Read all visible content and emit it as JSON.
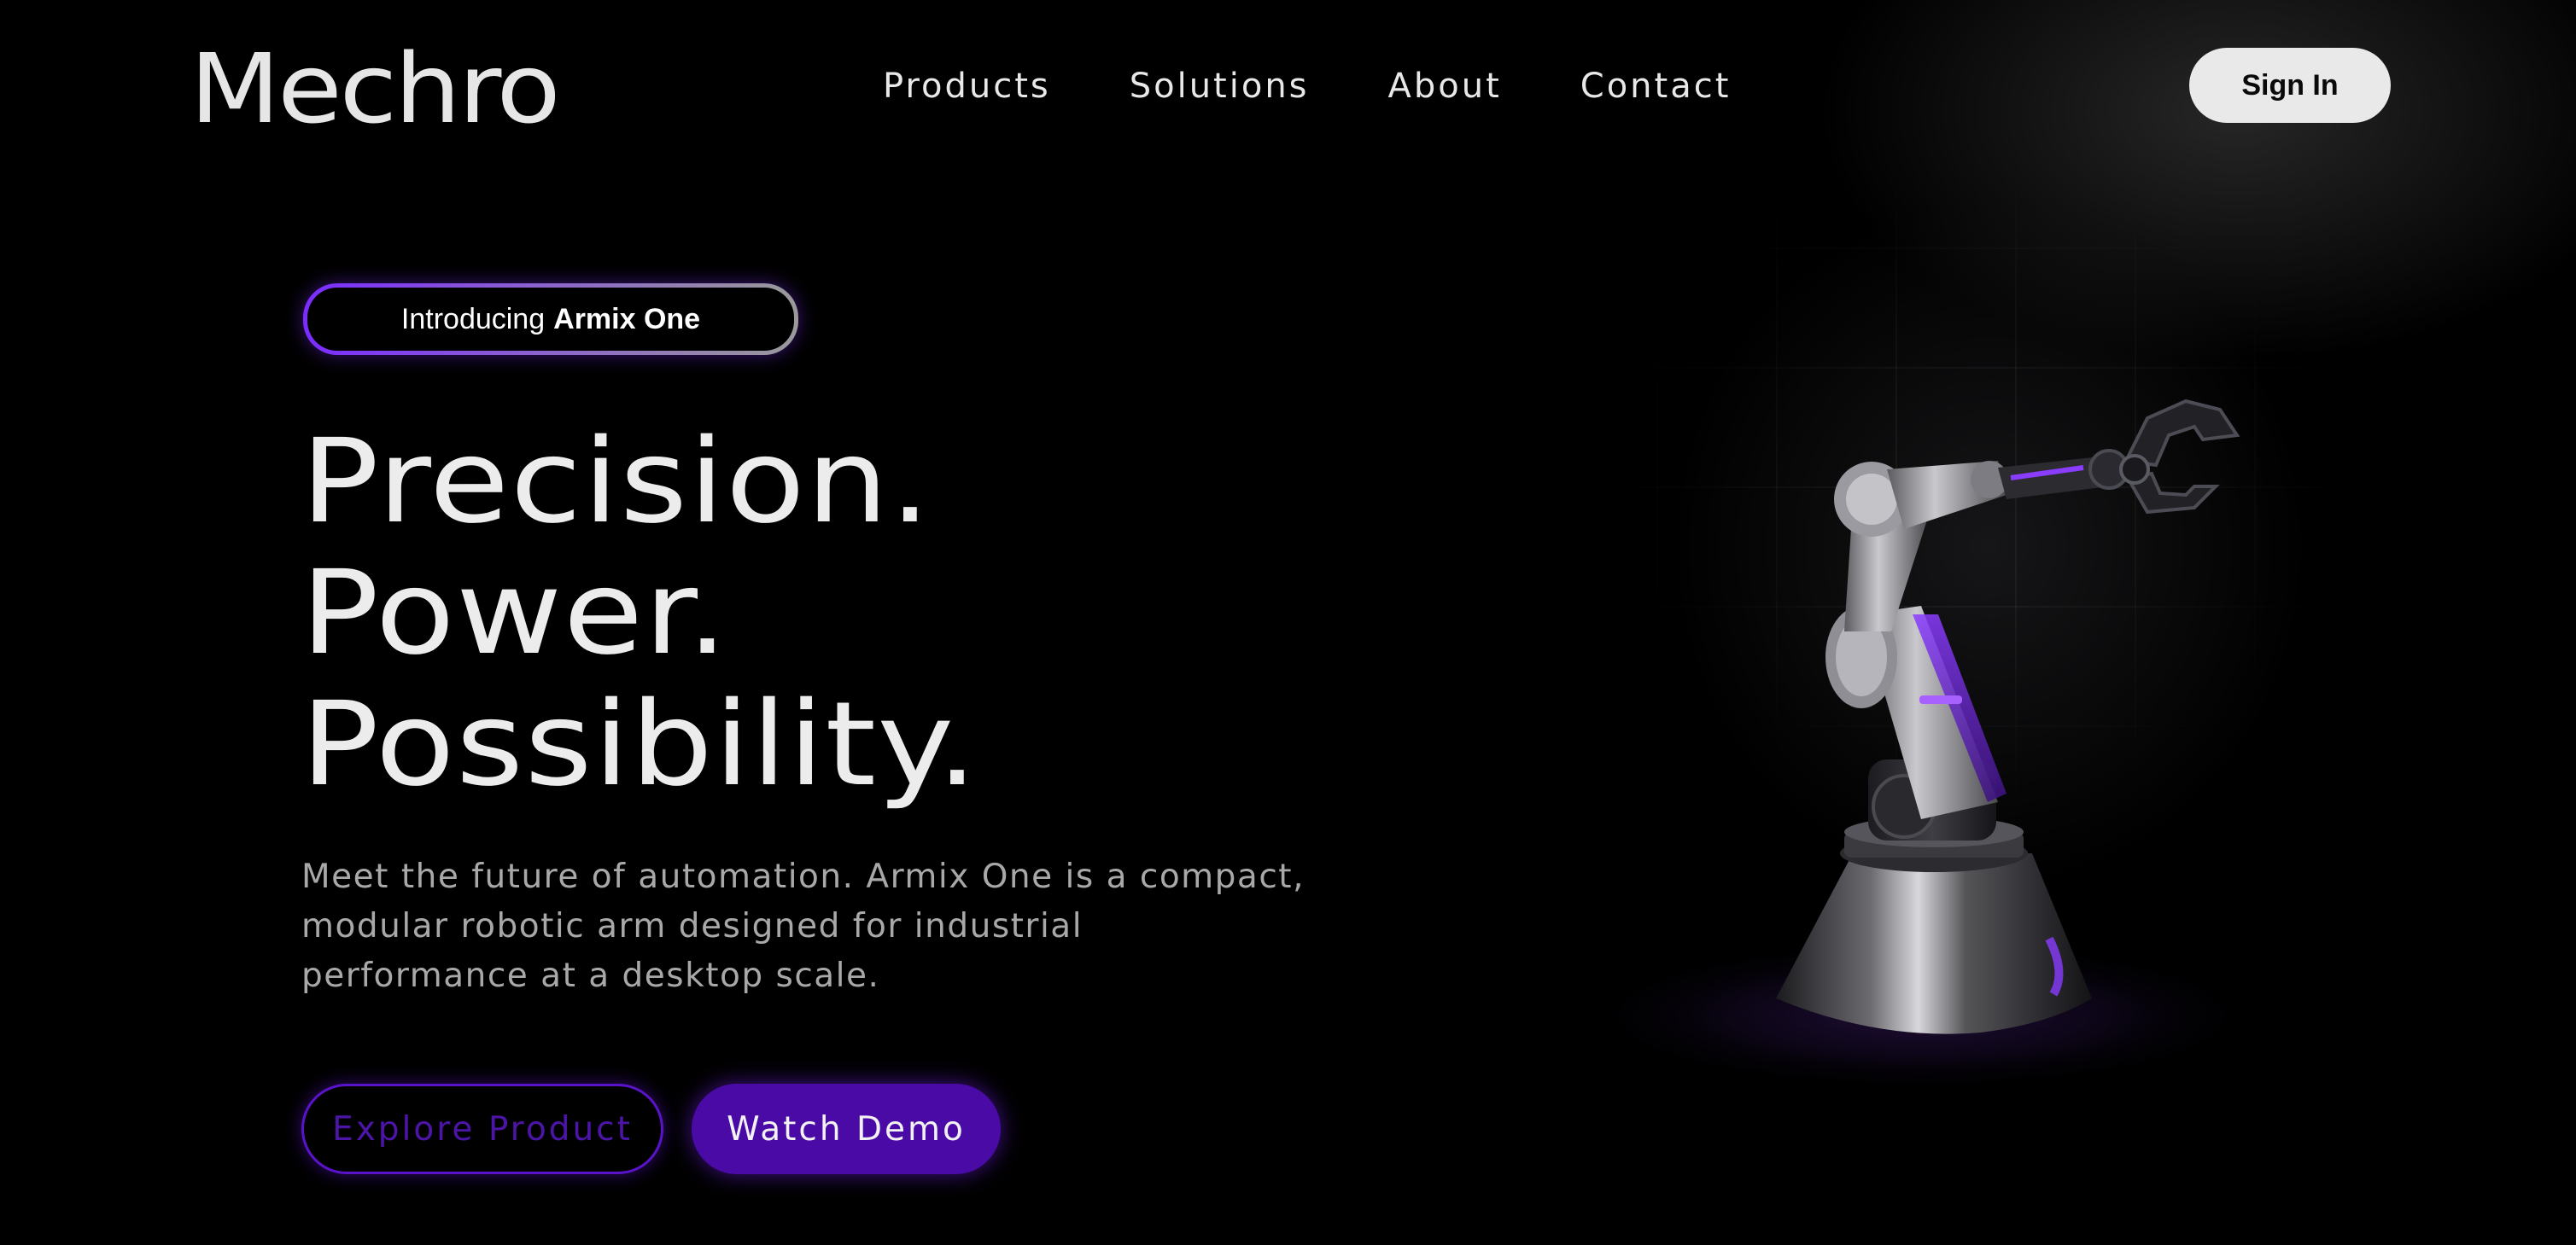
{
  "brand": {
    "logo_text": "Mechro"
  },
  "nav": {
    "items": [
      {
        "label": "Products"
      },
      {
        "label": "Solutions"
      },
      {
        "label": "About"
      },
      {
        "label": "Contact"
      }
    ],
    "signin_label": "Sign In"
  },
  "hero": {
    "badge_prefix": "Introducing",
    "badge_product": "Armix One",
    "headline_lines": [
      "Precision.",
      "Power.",
      "Possibility."
    ],
    "description": "Meet the future of automation. Armix One is a compact, modular robotic arm designed for industrial performance at a desktop scale.",
    "primary_cta": "Explore Product",
    "secondary_cta": "Watch Demo"
  },
  "theme": {
    "accent": "#4a0aa6",
    "accent_glow": "#7a2cff",
    "background": "#000000",
    "text": "#ececec",
    "muted_text": "#a8a8a8"
  },
  "icons": {
    "hero_illustration": "robotic-arm-illustration"
  }
}
